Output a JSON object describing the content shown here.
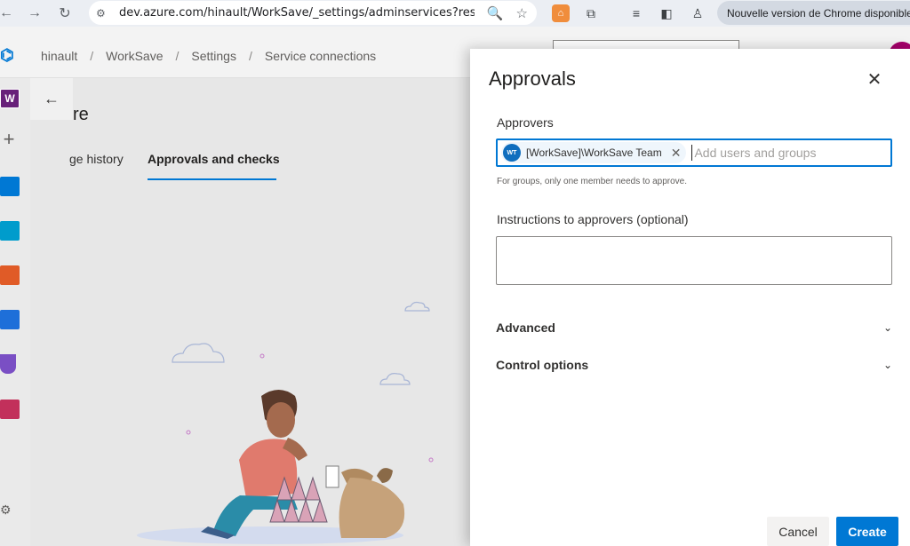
{
  "browser": {
    "url": "dev.azure.com/hinault/WorkSave/_settings/adminservices?resourc...",
    "update_label": "Nouvelle version de Chrome disponible"
  },
  "header": {
    "breadcrumb": [
      "hinault",
      "WorkSave",
      "Settings",
      "Service connections"
    ]
  },
  "sidebar": {
    "project_initial": "W"
  },
  "page": {
    "heading_fragment": "re",
    "tabs": [
      {
        "label": "ge history"
      },
      {
        "label": "Approvals and checks",
        "selected": true
      }
    ]
  },
  "dialog": {
    "title": "Approvals",
    "approvers_label": "Approvers",
    "approver_chip": {
      "initials": "WT",
      "name": "[WorkSave]\\WorkSave Team"
    },
    "add_placeholder": "Add users and groups",
    "help_text": "For groups, only one member needs to approve.",
    "instructions_label": "Instructions to approvers (optional)",
    "advanced_label": "Advanced",
    "control_options_label": "Control options",
    "cancel_label": "Cancel",
    "create_label": "Create"
  },
  "colors": {
    "accent": "#0078d4",
    "panel_background": "#ffffff",
    "page_background": "#e7e7e7"
  }
}
